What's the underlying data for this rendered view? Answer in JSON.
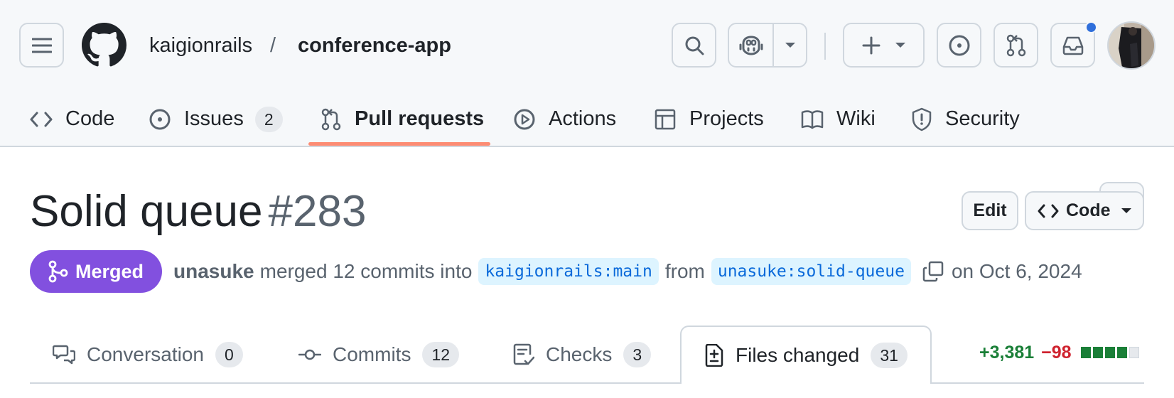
{
  "header": {
    "owner": "kaigionrails",
    "separator": "/",
    "repo": "conference-app",
    "nav": [
      {
        "label": "Code",
        "counter": null
      },
      {
        "label": "Issues",
        "counter": "2"
      },
      {
        "label": "Pull requests",
        "counter": null
      },
      {
        "label": "Actions",
        "counter": null
      },
      {
        "label": "Projects",
        "counter": null
      },
      {
        "label": "Wiki",
        "counter": null
      },
      {
        "label": "Security",
        "counter": null
      }
    ],
    "active_nav": "Pull requests"
  },
  "pr": {
    "title": "Solid queue",
    "number": "#283",
    "state": "Merged",
    "author": "unasuke",
    "merged_text": "merged 12 commits into",
    "base_branch": "kaigionrails:main",
    "from_text": "from",
    "head_branch": "unasuke:solid-queue",
    "date_text": "on Oct 6, 2024",
    "edit_label": "Edit",
    "code_label": "Code"
  },
  "tabs": [
    {
      "label": "Conversation",
      "counter": "0"
    },
    {
      "label": "Commits",
      "counter": "12"
    },
    {
      "label": "Checks",
      "counter": "3"
    },
    {
      "label": "Files changed",
      "counter": "31"
    }
  ],
  "diffstat": {
    "additions": "+3,381",
    "deletions": "−98",
    "blocks": [
      "add",
      "add",
      "add",
      "add",
      "neutral"
    ]
  },
  "colors": {
    "merged": "#8250df",
    "accent_underline": "#fd8c73",
    "link": "#0969da",
    "additions": "#1a7f37",
    "deletions": "#cf222e"
  }
}
